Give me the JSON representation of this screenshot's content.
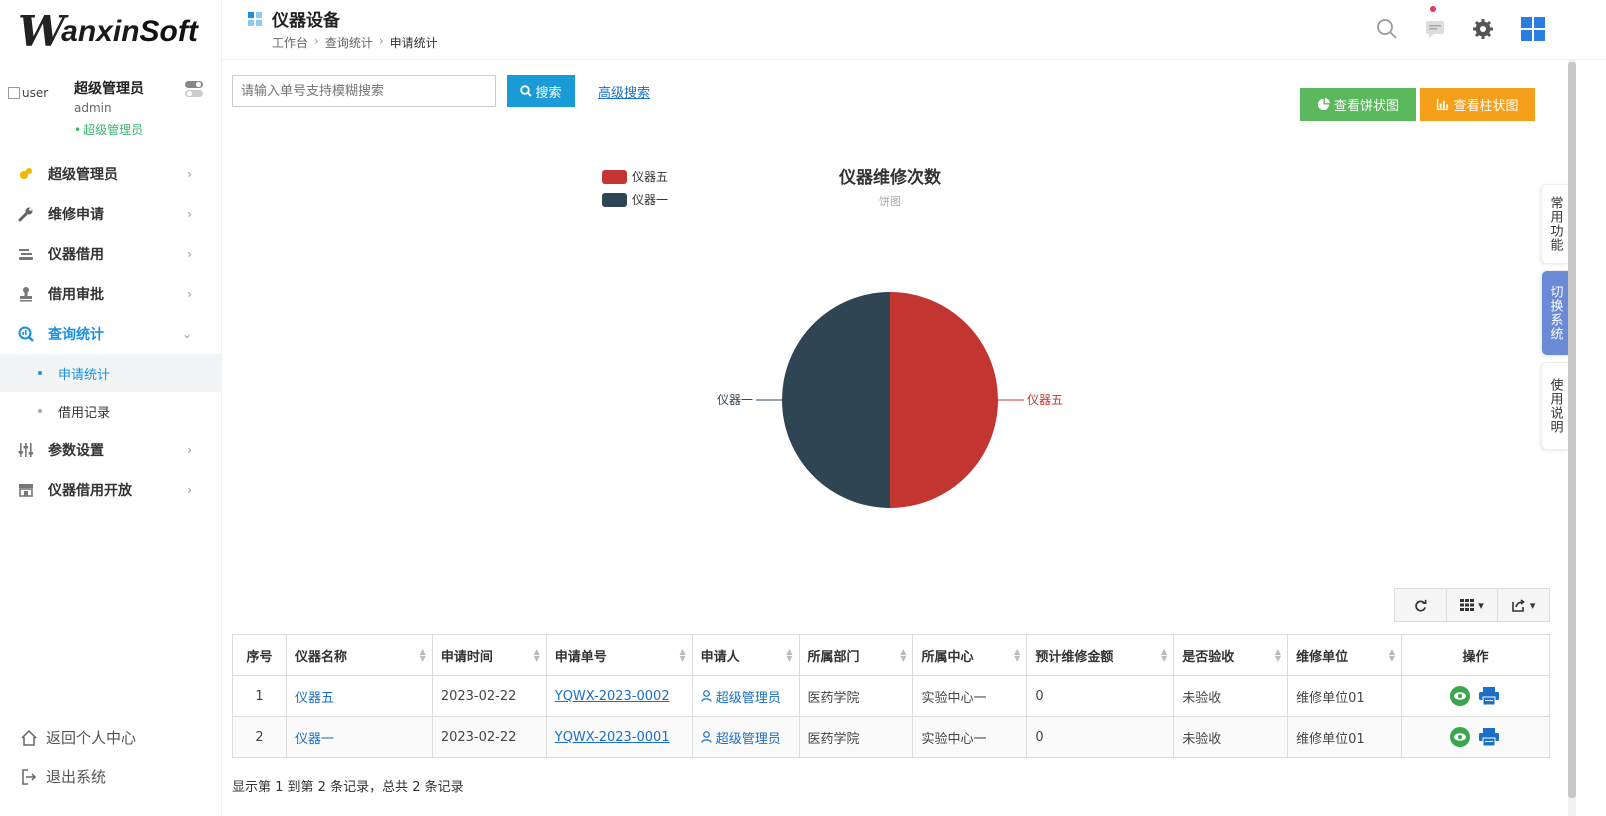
{
  "brand": {
    "w": "W",
    "part1": "anxin",
    "part2": "Soft"
  },
  "user": {
    "avatar_alt": "user",
    "name": "超级管理员",
    "login": "admin",
    "role": "超级管理员"
  },
  "menu": [
    {
      "label": "超级管理员",
      "icon": "people-icon"
    },
    {
      "label": "维修申请",
      "icon": "wrench-icon"
    },
    {
      "label": "仪器借用",
      "icon": "hand-icon"
    },
    {
      "label": "借用审批",
      "icon": "stamp-icon"
    },
    {
      "label": "查询统计",
      "icon": "chart-search-icon"
    },
    {
      "label": "参数设置",
      "icon": "sliders-icon"
    },
    {
      "label": "仪器借用开放",
      "icon": "store-icon"
    }
  ],
  "submenu": [
    {
      "label": "申请统计"
    },
    {
      "label": "借用记录"
    }
  ],
  "bottom_links": {
    "home": "返回个人中心",
    "logout": "退出系统"
  },
  "header": {
    "title": "仪器设备",
    "breadcrumb": [
      "工作台",
      "查询统计",
      "申请统计"
    ]
  },
  "search": {
    "placeholder": "请输入单号支持模糊搜索",
    "button": "搜索",
    "advanced": "高级搜索"
  },
  "chart_buttons": {
    "pie": "查看饼状图",
    "bar": "查看柱状图"
  },
  "chart_data": {
    "type": "pie",
    "title": "仪器维修次数",
    "subtitle": "饼图",
    "legend_position": "top-left",
    "slices": [
      {
        "name": "仪器五",
        "value": 1,
        "color": "#c23531"
      },
      {
        "name": "仪器一",
        "value": 1,
        "color": "#2f4554"
      }
    ]
  },
  "table": {
    "columns": [
      "序号",
      "仪器名称",
      "申请时间",
      "申请单号",
      "申请人",
      "所属部门",
      "所属中心",
      "预计维修金额",
      "是否验收",
      "维修单位",
      "操作"
    ],
    "rows": [
      {
        "no": "1",
        "name": "仪器五",
        "date": "2023-02-22",
        "order": "YQWX-2023-0002",
        "applicant": "超级管理员",
        "dept": "医药学院",
        "center": "实验中心一",
        "amount": "0",
        "accepted": "未验收",
        "unit": "维修单位01"
      },
      {
        "no": "2",
        "name": "仪器一",
        "date": "2023-02-22",
        "order": "YQWX-2023-0001",
        "applicant": "超级管理员",
        "dept": "医药学院",
        "center": "实验中心一",
        "amount": "0",
        "accepted": "未验收",
        "unit": "维修单位01"
      }
    ],
    "footer": "显示第 1 到第 2 条记录，总共 2 条记录"
  },
  "side_tabs": [
    "常用功能",
    "切换系统",
    "使用说明"
  ],
  "colors": {
    "accent": "#1a8fe0",
    "search": "#1a9bd7",
    "pie_btn": "#5cb85c",
    "bar_btn": "#f5a01a",
    "role": "#3cb46e"
  }
}
